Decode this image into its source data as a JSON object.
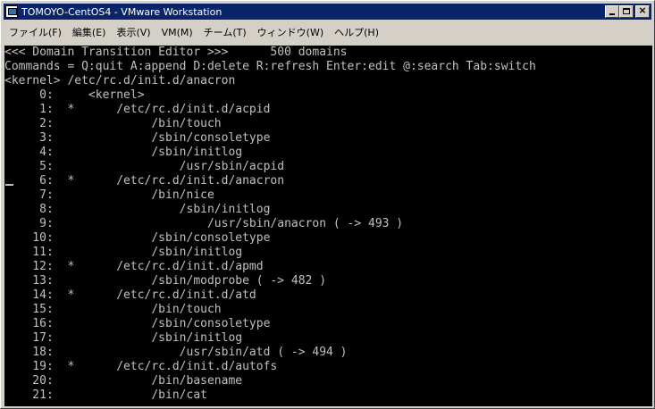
{
  "window": {
    "title": "TOMOYO-CentOS4 - VMware Workstation"
  },
  "menubar": {
    "items": [
      "ファイル(F)",
      "編集(E)",
      "表示(V)",
      "VM(M)",
      "チーム(T)",
      "ウィンドウ(W)",
      "ヘルプ(H)"
    ]
  },
  "terminal": {
    "lines": [
      "<<< Domain Transition Editor >>>      500 domains",
      "Commands = Q:quit A:append D:delete R:refresh Enter:edit @:search Tab:switch",
      "<kernel> /etc/rc.d/init.d/anacron",
      "     0:     <kernel>",
      "     1:  *      /etc/rc.d/init.d/acpid",
      "     2:              /bin/touch",
      "     3:              /sbin/consoletype",
      "     4:              /sbin/initlog",
      "     5:                  /usr/sbin/acpid",
      "     6:  *      /etc/rc.d/init.d/anacron",
      "     7:              /bin/nice",
      "     8:                  /sbin/initlog",
      "     9:                      /usr/sbin/anacron ( -> 493 )",
      "    10:              /sbin/consoletype",
      "    11:              /sbin/initlog",
      "    12:  *      /etc/rc.d/init.d/apmd",
      "    13:              /sbin/modprobe ( -> 482 )",
      "    14:  *      /etc/rc.d/init.d/atd",
      "    15:              /bin/touch",
      "    16:              /sbin/consoletype",
      "    17:              /sbin/initlog",
      "    18:                  /usr/sbin/atd ( -> 494 )",
      "    19:  *      /etc/rc.d/init.d/autofs",
      "    20:              /bin/basename",
      "    21:              /bin/cat"
    ]
  }
}
